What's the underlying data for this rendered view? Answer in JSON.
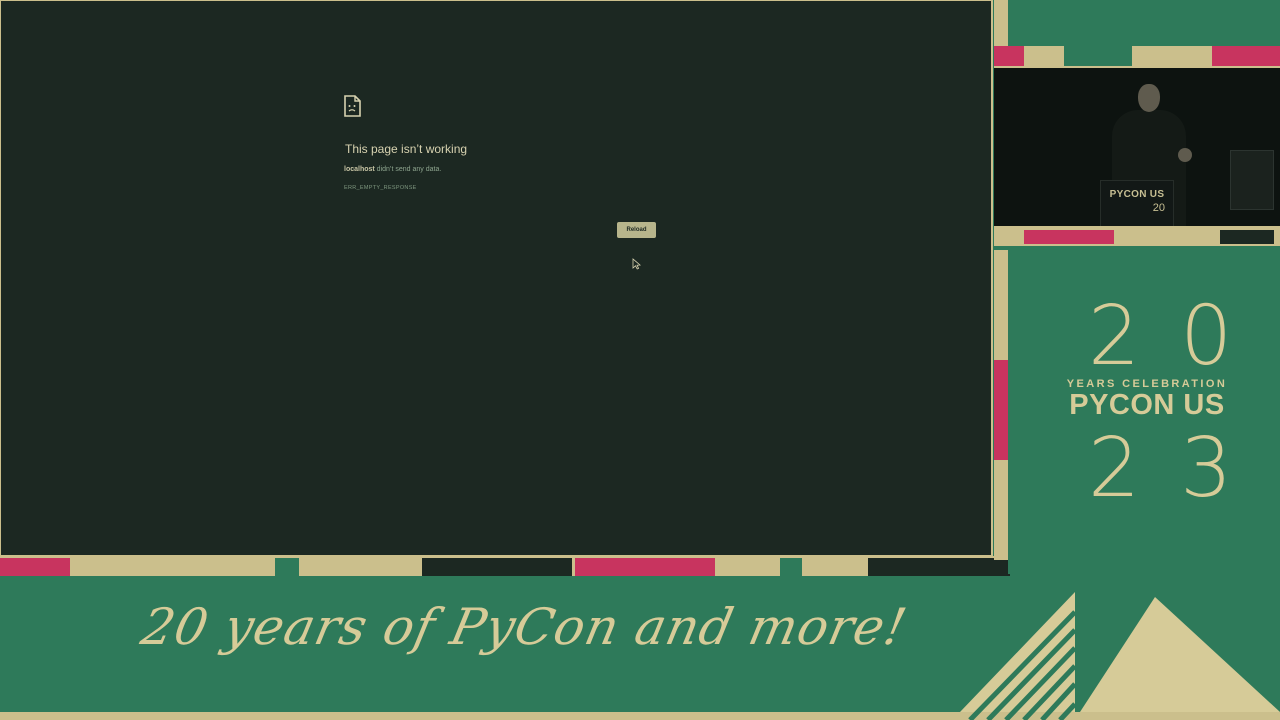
{
  "browser": {
    "error_icon": "sad-page-icon",
    "title": "This page isn’t working",
    "host": "localhost",
    "detail": " didn’t send any data.",
    "error_code": "ERR_EMPTY_RESPONSE",
    "reload_label": "Reload",
    "cursor_icon": "mouse-pointer-icon"
  },
  "camera": {
    "podium_name": "PYCON US",
    "podium_year": "20"
  },
  "logo": {
    "year_top": "20",
    "subtitle": "YEARS CELEBRATION",
    "name": "PYCON US",
    "year_bottom": "23"
  },
  "banner": {
    "tagline": "20 years of PyCon and more!"
  },
  "colors": {
    "background_green": "#2e7a5a",
    "accent_cream": "#cbbf8c",
    "accent_pink": "#c8345f",
    "browser_dark": "#1c2822"
  }
}
